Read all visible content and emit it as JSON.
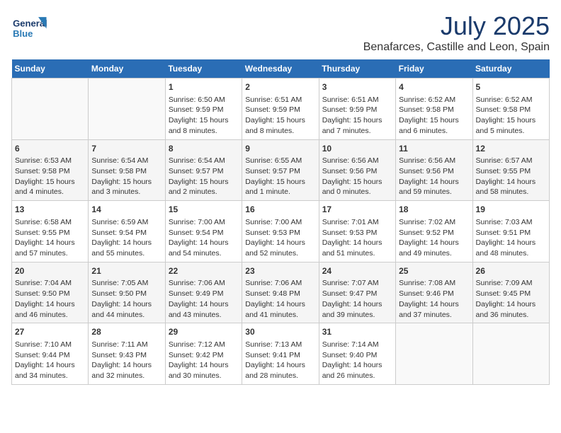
{
  "header": {
    "logo_general": "General",
    "logo_blue": "Blue",
    "month": "July 2025",
    "location": "Benafarces, Castille and Leon, Spain"
  },
  "days_of_week": [
    "Sunday",
    "Monday",
    "Tuesday",
    "Wednesday",
    "Thursday",
    "Friday",
    "Saturday"
  ],
  "weeks": [
    [
      {
        "day": "",
        "info": ""
      },
      {
        "day": "",
        "info": ""
      },
      {
        "day": "1",
        "info": "Sunrise: 6:50 AM\nSunset: 9:59 PM\nDaylight: 15 hours\nand 8 minutes."
      },
      {
        "day": "2",
        "info": "Sunrise: 6:51 AM\nSunset: 9:59 PM\nDaylight: 15 hours\nand 8 minutes."
      },
      {
        "day": "3",
        "info": "Sunrise: 6:51 AM\nSunset: 9:59 PM\nDaylight: 15 hours\nand 7 minutes."
      },
      {
        "day": "4",
        "info": "Sunrise: 6:52 AM\nSunset: 9:58 PM\nDaylight: 15 hours\nand 6 minutes."
      },
      {
        "day": "5",
        "info": "Sunrise: 6:52 AM\nSunset: 9:58 PM\nDaylight: 15 hours\nand 5 minutes."
      }
    ],
    [
      {
        "day": "6",
        "info": "Sunrise: 6:53 AM\nSunset: 9:58 PM\nDaylight: 15 hours\nand 4 minutes."
      },
      {
        "day": "7",
        "info": "Sunrise: 6:54 AM\nSunset: 9:58 PM\nDaylight: 15 hours\nand 3 minutes."
      },
      {
        "day": "8",
        "info": "Sunrise: 6:54 AM\nSunset: 9:57 PM\nDaylight: 15 hours\nand 2 minutes."
      },
      {
        "day": "9",
        "info": "Sunrise: 6:55 AM\nSunset: 9:57 PM\nDaylight: 15 hours\nand 1 minute."
      },
      {
        "day": "10",
        "info": "Sunrise: 6:56 AM\nSunset: 9:56 PM\nDaylight: 15 hours\nand 0 minutes."
      },
      {
        "day": "11",
        "info": "Sunrise: 6:56 AM\nSunset: 9:56 PM\nDaylight: 14 hours\nand 59 minutes."
      },
      {
        "day": "12",
        "info": "Sunrise: 6:57 AM\nSunset: 9:55 PM\nDaylight: 14 hours\nand 58 minutes."
      }
    ],
    [
      {
        "day": "13",
        "info": "Sunrise: 6:58 AM\nSunset: 9:55 PM\nDaylight: 14 hours\nand 57 minutes."
      },
      {
        "day": "14",
        "info": "Sunrise: 6:59 AM\nSunset: 9:54 PM\nDaylight: 14 hours\nand 55 minutes."
      },
      {
        "day": "15",
        "info": "Sunrise: 7:00 AM\nSunset: 9:54 PM\nDaylight: 14 hours\nand 54 minutes."
      },
      {
        "day": "16",
        "info": "Sunrise: 7:00 AM\nSunset: 9:53 PM\nDaylight: 14 hours\nand 52 minutes."
      },
      {
        "day": "17",
        "info": "Sunrise: 7:01 AM\nSunset: 9:53 PM\nDaylight: 14 hours\nand 51 minutes."
      },
      {
        "day": "18",
        "info": "Sunrise: 7:02 AM\nSunset: 9:52 PM\nDaylight: 14 hours\nand 49 minutes."
      },
      {
        "day": "19",
        "info": "Sunrise: 7:03 AM\nSunset: 9:51 PM\nDaylight: 14 hours\nand 48 minutes."
      }
    ],
    [
      {
        "day": "20",
        "info": "Sunrise: 7:04 AM\nSunset: 9:50 PM\nDaylight: 14 hours\nand 46 minutes."
      },
      {
        "day": "21",
        "info": "Sunrise: 7:05 AM\nSunset: 9:50 PM\nDaylight: 14 hours\nand 44 minutes."
      },
      {
        "day": "22",
        "info": "Sunrise: 7:06 AM\nSunset: 9:49 PM\nDaylight: 14 hours\nand 43 minutes."
      },
      {
        "day": "23",
        "info": "Sunrise: 7:06 AM\nSunset: 9:48 PM\nDaylight: 14 hours\nand 41 minutes."
      },
      {
        "day": "24",
        "info": "Sunrise: 7:07 AM\nSunset: 9:47 PM\nDaylight: 14 hours\nand 39 minutes."
      },
      {
        "day": "25",
        "info": "Sunrise: 7:08 AM\nSunset: 9:46 PM\nDaylight: 14 hours\nand 37 minutes."
      },
      {
        "day": "26",
        "info": "Sunrise: 7:09 AM\nSunset: 9:45 PM\nDaylight: 14 hours\nand 36 minutes."
      }
    ],
    [
      {
        "day": "27",
        "info": "Sunrise: 7:10 AM\nSunset: 9:44 PM\nDaylight: 14 hours\nand 34 minutes."
      },
      {
        "day": "28",
        "info": "Sunrise: 7:11 AM\nSunset: 9:43 PM\nDaylight: 14 hours\nand 32 minutes."
      },
      {
        "day": "29",
        "info": "Sunrise: 7:12 AM\nSunset: 9:42 PM\nDaylight: 14 hours\nand 30 minutes."
      },
      {
        "day": "30",
        "info": "Sunrise: 7:13 AM\nSunset: 9:41 PM\nDaylight: 14 hours\nand 28 minutes."
      },
      {
        "day": "31",
        "info": "Sunrise: 7:14 AM\nSunset: 9:40 PM\nDaylight: 14 hours\nand 26 minutes."
      },
      {
        "day": "",
        "info": ""
      },
      {
        "day": "",
        "info": ""
      }
    ]
  ]
}
